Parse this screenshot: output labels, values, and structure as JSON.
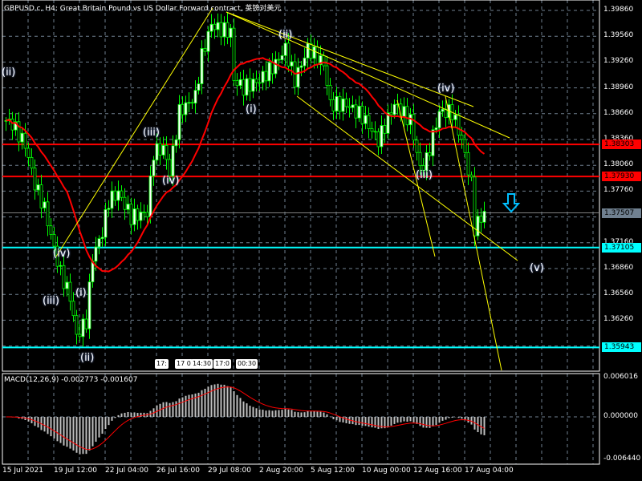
{
  "title": "GBPUSD.c, H4:  Great Britain Pound vs US Dollar Forward contract, 英镑对美元",
  "macd_label": "MACD(12,26,9) -0.002773 -0.001607",
  "colors": {
    "background": "#000000",
    "candle": "#00ff00",
    "bull_body": "#ffffff",
    "ma": "#ff0000",
    "trend": "#ffff00",
    "support": "#00ffff",
    "arrow": "#00bfff",
    "grid": "#708090"
  },
  "price_axis": [
    "1.39860",
    "1.39560",
    "1.39260",
    "1.38960",
    "1.38660",
    "1.38360",
    "1.38060",
    "1.37760",
    "1.37460",
    "1.37160",
    "1.36860",
    "1.36560",
    "1.36260"
  ],
  "price_tags": [
    {
      "label": "1.38303",
      "value": 1.38303,
      "kind": "resistance"
    },
    {
      "label": "1.37930",
      "value": 1.3793,
      "kind": "resistance"
    },
    {
      "label": "1.37507",
      "value": 1.37507,
      "kind": "current"
    },
    {
      "label": "1.37105",
      "value": 1.37105,
      "kind": "support"
    },
    {
      "label": "1.35943",
      "value": 1.35943,
      "kind": "support"
    }
  ],
  "macd_axis": [
    "0.006016",
    "0.000000",
    "-0.006440"
  ],
  "time_axis": [
    "15 Jul 2021",
    "19 Jul 12:00",
    "22 Jul 04:00",
    "26 Jul 16:00",
    "29 Jul 08:00",
    "2 Aug 20:00",
    "5 Aug 12:00",
    "10 Aug 00:00",
    "12 Aug 16:00",
    "17 Aug 04:00"
  ],
  "time_boxes": [
    "17:",
    "17 0",
    "14:30",
    "17:0",
    "00:30"
  ],
  "wave_labels": [
    "(ii)",
    "(iii)",
    "(iv)",
    "(iv)",
    "(iii)",
    "(i)",
    "(ii)",
    "(i)",
    "(ii)",
    "(iii)",
    "(iv)",
    "(v)"
  ],
  "chart_data": {
    "type": "candlestick",
    "symbol": "GBPUSD.c",
    "timeframe": "H4",
    "ylim": [
      1.3575,
      1.3995
    ],
    "bars": 150,
    "close_path": [
      [
        0,
        1.3858
      ],
      [
        2,
        1.3854
      ],
      [
        6,
        1.383
      ],
      [
        9,
        1.3784
      ],
      [
        12,
        1.3756
      ],
      [
        15,
        1.3709
      ],
      [
        17,
        1.3681
      ],
      [
        20,
        1.3653
      ],
      [
        22,
        1.3607
      ],
      [
        25,
        1.3625
      ],
      [
        27,
        1.37
      ],
      [
        30,
        1.3728
      ],
      [
        32,
        1.3765
      ],
      [
        35,
        1.3774
      ],
      [
        39,
        1.3746
      ],
      [
        44,
        1.3751
      ],
      [
        46,
        1.3821
      ],
      [
        49,
        1.3826
      ],
      [
        51,
        1.3798
      ],
      [
        54,
        1.3868
      ],
      [
        59,
        1.3886
      ],
      [
        61,
        1.3933
      ],
      [
        64,
        1.397
      ],
      [
        66,
        1.3965
      ],
      [
        70,
        1.3961
      ],
      [
        71,
        1.3905
      ],
      [
        74,
        1.3896
      ],
      [
        79,
        1.3905
      ],
      [
        84,
        1.3924
      ],
      [
        87,
        1.3942
      ],
      [
        90,
        1.3905
      ],
      [
        94,
        1.3942
      ],
      [
        99,
        1.3924
      ],
      [
        101,
        1.3877
      ],
      [
        106,
        1.3877
      ],
      [
        111,
        1.3863
      ],
      [
        116,
        1.3835
      ],
      [
        121,
        1.3877
      ],
      [
        126,
        1.3858
      ],
      [
        129,
        1.3802
      ],
      [
        131,
        1.3812
      ],
      [
        135,
        1.3868
      ],
      [
        139,
        1.3868
      ],
      [
        142,
        1.3835
      ],
      [
        145,
        1.3784
      ],
      [
        146,
        1.3733
      ],
      [
        149,
        1.3751
      ]
    ],
    "ma_period": 20,
    "macd": {
      "fast": 12,
      "slow": 26,
      "signal": 9,
      "main": -0.002773,
      "signal_value": -0.001607,
      "ylim": [
        -0.00644,
        0.006016
      ]
    }
  }
}
